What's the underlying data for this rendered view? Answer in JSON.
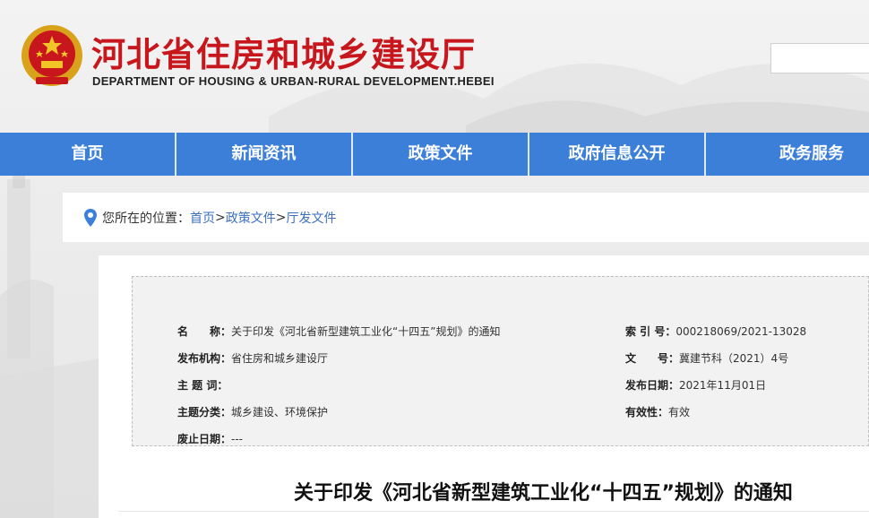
{
  "header": {
    "title": "河北省住房和城乡建设厅",
    "subtitle": "DEPARTMENT OF HOUSING & URBAN-RURAL DEVELOPMENT.HEBEI",
    "search_value": ""
  },
  "nav": {
    "items": [
      {
        "label": "首页"
      },
      {
        "label": "新闻资讯"
      },
      {
        "label": "政策文件"
      },
      {
        "label": "政府信息公开"
      },
      {
        "label": "政务服务"
      }
    ]
  },
  "breadcrumb": {
    "label": "您所在的位置：",
    "items": [
      "首页",
      "政策文件",
      "厅发文件"
    ],
    "separator": ">"
  },
  "meta": {
    "name_key": "名　　称：",
    "name_val": "关于印发《河北省新型建筑工业化“十四五”规划》的通知",
    "index_key": "索 引 号：",
    "index_val": "000218069/2021-13028",
    "publisher_key": "发布机构：",
    "publisher_val": "省住房和城乡建设厅",
    "docno_key": "文　　号：",
    "docno_val": "冀建节科（2021）4号",
    "subject_words_key": "主 题 词：",
    "subject_words_val": "",
    "date_key": "发布日期：",
    "date_val": "2021年11月01日",
    "category_key": "主题分类：",
    "category_val": "城乡建设、环境保护",
    "validity_key": "有效性：",
    "validity_val": "有效",
    "expiry_key": "废止日期：",
    "expiry_val": "---"
  },
  "document": {
    "title": "关于印发《河北省新型建筑工业化“十四五”规划》的通知"
  },
  "colors": {
    "nav_bg": "#3c7fd9",
    "title_red": "#c8161d",
    "link_blue": "#3a6fbf"
  },
  "icons": {
    "emblem": "national-emblem-icon",
    "pin": "location-pin-icon"
  }
}
